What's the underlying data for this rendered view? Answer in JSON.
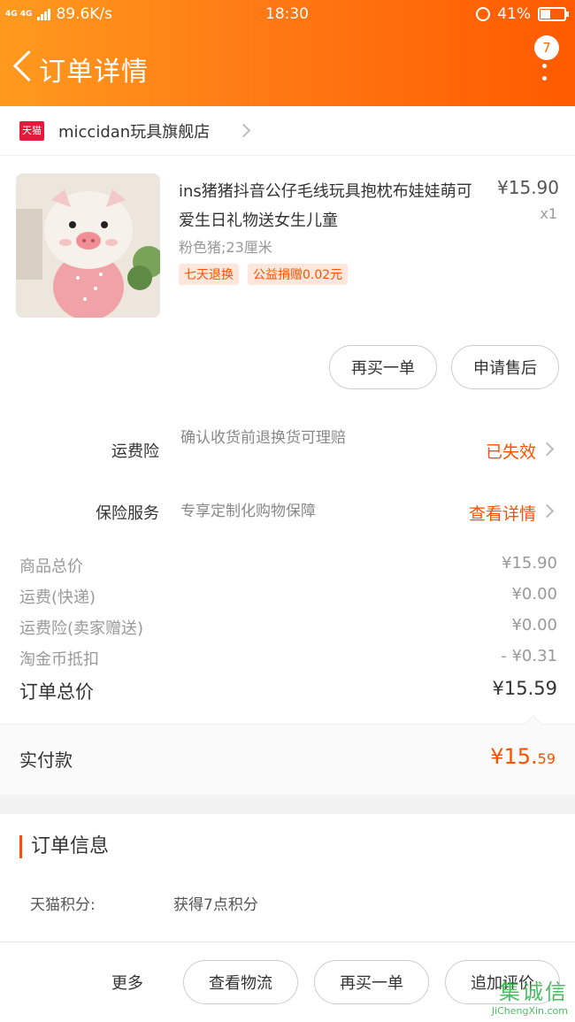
{
  "status_bar": {
    "network": "4G 4G",
    "speed": "89.6K/s",
    "time": "18:30",
    "battery": "41%",
    "battery_level": 0.41
  },
  "nav": {
    "title": "订单详情",
    "message_count": "7"
  },
  "store": {
    "badge": "天猫",
    "name": "miccidan玩具旗舰店"
  },
  "product": {
    "name": "ins猪猪抖音公仔毛线玩具抱枕布娃娃萌可爱生日礼物送女生儿童",
    "price": "¥15.90",
    "quantity": "x1",
    "sku": "粉色猪;23厘米",
    "tags": [
      "七天退换",
      "公益捐赠0.02元"
    ]
  },
  "product_actions": {
    "buy_again": "再买一单",
    "after_sale": "申请售后"
  },
  "services": [
    {
      "label": "运费险",
      "desc": "确认收货前退换货可理赔",
      "status": "已失效"
    },
    {
      "label": "保险服务",
      "desc": "专享定制化购物保障",
      "status": "查看详情"
    }
  ],
  "totals": {
    "rows": [
      {
        "label": "商品总价",
        "value": "¥15.90"
      },
      {
        "label": "运费(快递)",
        "value": "¥0.00"
      },
      {
        "label": "运费险(卖家赠送)",
        "value": "¥0.00"
      },
      {
        "label": "淘金币抵扣",
        "value": "- ¥0.31"
      }
    ],
    "order_total_label": "订单总价",
    "order_total_value": "¥15.59"
  },
  "paid": {
    "label": "实付款",
    "amount_main": "¥15.",
    "amount_cents": "59"
  },
  "order_info": {
    "title": "订单信息",
    "points_label": "天猫积分:",
    "points_value": "获得7点积分"
  },
  "bottom_bar": {
    "more": "更多",
    "buttons": [
      "查看物流",
      "再买一单",
      "追加评价"
    ]
  },
  "watermark": {
    "name": "集诚信",
    "url": "JiChengXin.com"
  },
  "colors": {
    "accent": "#ff5000",
    "header_start": "#ff9a1e",
    "header_end": "#ff5a00",
    "tmall_red": "#e8173c"
  }
}
